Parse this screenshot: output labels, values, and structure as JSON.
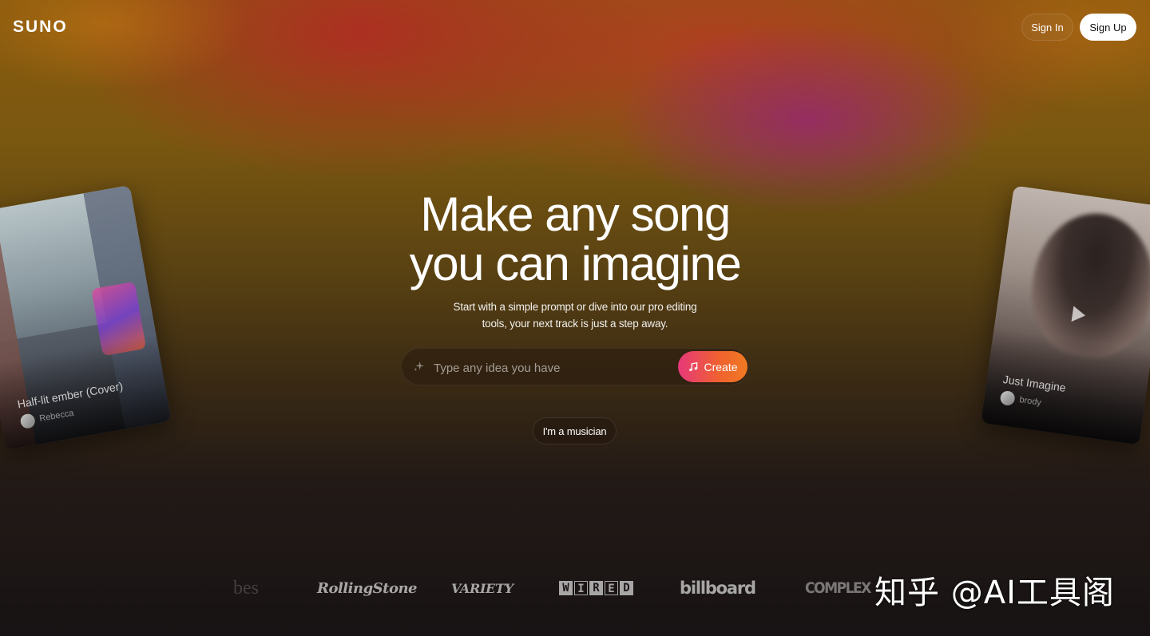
{
  "header": {
    "logo": "SUNO",
    "sign_in_label": "Sign In",
    "sign_up_label": "Sign Up"
  },
  "hero": {
    "headline_line1": "Make any song",
    "headline_line2": "you can imagine",
    "subtitle_line1": "Start with a simple prompt or dive into our pro editing",
    "subtitle_line2": "tools, your next track is just a step away.",
    "prompt_placeholder": "Type any idea you have",
    "create_label": "Create",
    "musician_label": "I'm a musician"
  },
  "cards": [
    {
      "title": "Half-lit ember (Cover)",
      "author": "Rebecca"
    },
    {
      "title": "Just Imagine",
      "author": "brody"
    }
  ],
  "press": {
    "forbes": "bes",
    "rollingstone": "RollingStone",
    "variety": "VARIETY",
    "wired": [
      "W",
      "I",
      "R",
      "E",
      "D"
    ],
    "billboard": "billboard",
    "complex": "COMPLEX"
  },
  "watermark": "知乎 @AI工具阁",
  "colors": {
    "accent_start": "#e6387a",
    "accent_end": "#f07a22"
  },
  "icons": {
    "prompt": "sparkle-icon",
    "create": "music-note-icon",
    "card_play": "play-icon"
  }
}
